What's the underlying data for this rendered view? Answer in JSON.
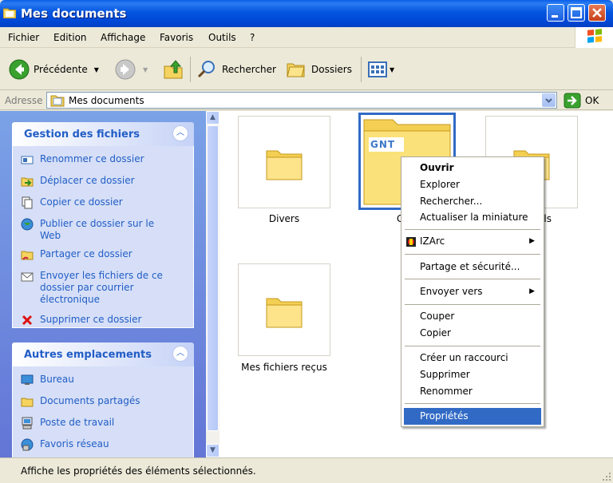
{
  "window": {
    "title": "Mes documents"
  },
  "menubar": {
    "items": [
      "Fichier",
      "Edition",
      "Affichage",
      "Favoris",
      "Outils",
      "?"
    ]
  },
  "toolbar": {
    "back_label": "Précédente",
    "search_label": "Rechercher",
    "folders_label": "Dossiers"
  },
  "addressbar": {
    "label": "Adresse",
    "value": "Mes documents",
    "go_label": "OK"
  },
  "left_panel": {
    "file_tasks": {
      "title": "Gestion des fichiers",
      "items": [
        {
          "label": "Renommer ce dossier",
          "icon": "rename-icon"
        },
        {
          "label": "Déplacer ce dossier",
          "icon": "move-folder-icon"
        },
        {
          "label": "Copier ce dossier",
          "icon": "copy-folder-icon"
        },
        {
          "label": "Publier ce dossier sur le Web",
          "icon": "publish-web-icon"
        },
        {
          "label": "Partager ce dossier",
          "icon": "share-folder-icon"
        },
        {
          "label": "Envoyer les fichiers de ce dossier par courrier électronique",
          "icon": "email-icon"
        },
        {
          "label": "Supprimer ce dossier",
          "icon": "delete-icon"
        }
      ]
    },
    "other_places": {
      "title": "Autres emplacements",
      "items": [
        {
          "label": "Bureau",
          "icon": "desktop-icon"
        },
        {
          "label": "Documents partagés",
          "icon": "shared-documents-icon"
        },
        {
          "label": "Poste de travail",
          "icon": "my-computer-icon"
        },
        {
          "label": "Favoris réseau",
          "icon": "network-places-icon"
        }
      ]
    }
  },
  "content": {
    "folders": [
      {
        "name": "Divers"
      },
      {
        "name": "G",
        "selected": true,
        "thumbnail_text": "GNT"
      },
      {
        "name": "ls"
      },
      {
        "name": "Mes fichiers reçus"
      }
    ]
  },
  "context_menu": {
    "items": [
      {
        "label": "Ouvrir",
        "bold": true
      },
      {
        "label": "Explorer"
      },
      {
        "label": "Rechercher..."
      },
      {
        "label": "Actualiser la miniature"
      },
      {
        "label": "IZArc",
        "submenu": true
      },
      {
        "label": "Partage et sécurité..."
      },
      {
        "label": "Envoyer vers",
        "submenu": true
      },
      {
        "label": "Couper"
      },
      {
        "label": "Copier"
      },
      {
        "label": "Créer un raccourci"
      },
      {
        "label": "Supprimer"
      },
      {
        "label": "Renommer"
      },
      {
        "label": "Propriétés",
        "highlighted": true
      }
    ]
  },
  "statusbar": {
    "text": "Affiche les propriétés des éléments sélectionnés."
  },
  "colors": {
    "selection": "#316ac5",
    "titlebar": "#0054e3",
    "task_link": "#215dc6"
  }
}
